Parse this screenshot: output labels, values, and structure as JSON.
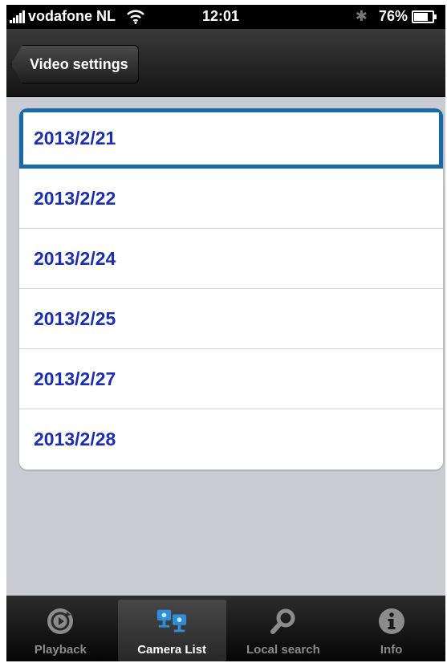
{
  "status_bar": {
    "carrier": "vodafone NL",
    "time": "12:01",
    "battery_percent": "76%",
    "battery_level": 0.76
  },
  "nav_bar": {
    "back_label": "Video settings"
  },
  "list": {
    "items": [
      {
        "label": "2013/2/21"
      },
      {
        "label": "2013/2/22"
      },
      {
        "label": "2013/2/24"
      },
      {
        "label": "2013/2/25"
      },
      {
        "label": "2013/2/27"
      },
      {
        "label": "2013/2/28"
      }
    ],
    "selected_index": 0
  },
  "tab_bar": {
    "tabs": [
      {
        "label": "Playback",
        "icon": "playback-icon"
      },
      {
        "label": "Camera List",
        "icon": "camera-list-icon"
      },
      {
        "label": "Local search",
        "icon": "search-icon"
      },
      {
        "label": "Info",
        "icon": "info-icon"
      }
    ],
    "active_index": 1
  },
  "colors": {
    "link_text": "#1a2db4",
    "selection_border": "#1769a9",
    "background": "#c9ccd3",
    "camera_icon": "#2f8fd6"
  }
}
